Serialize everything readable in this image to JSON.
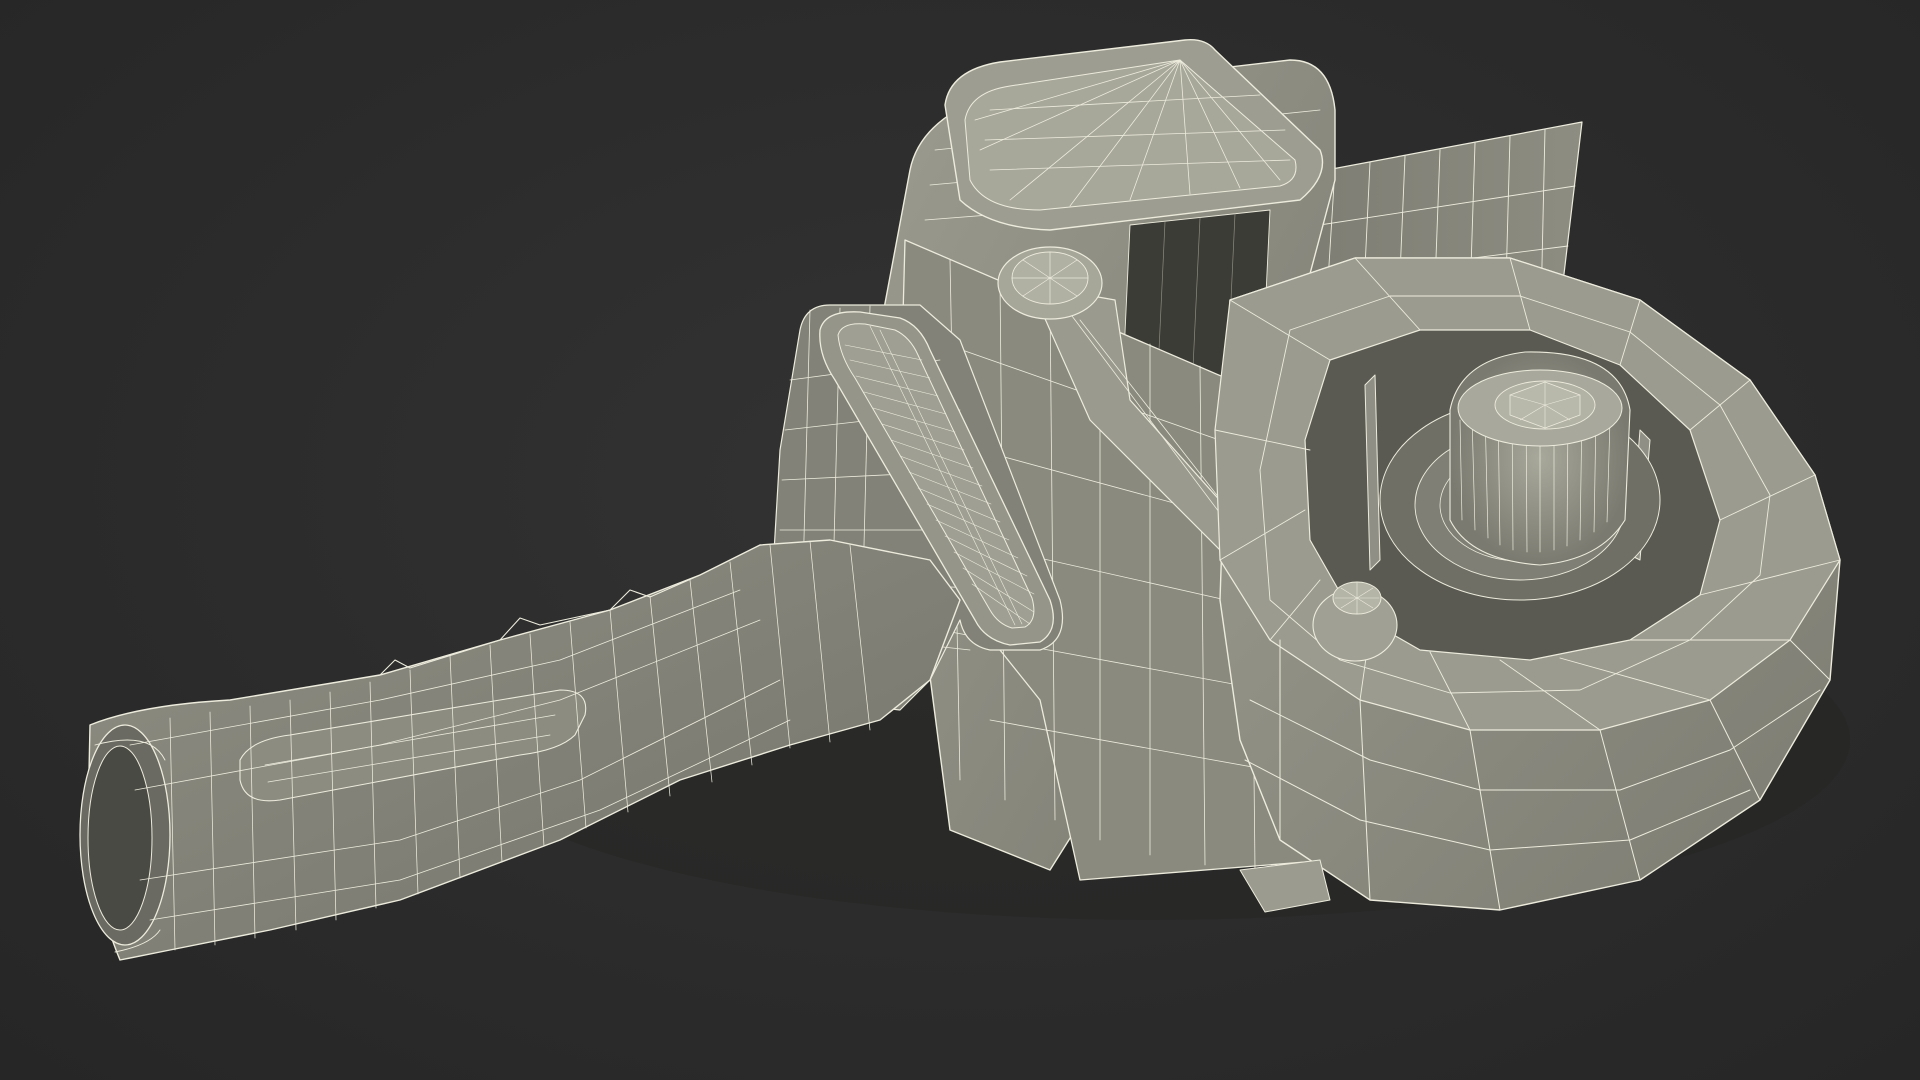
{
  "scene": {
    "background_color": "#2c2c2c",
    "surface_color": "#8a8a7e",
    "surface_light_color": "#a3a396",
    "surface_dark_color": "#55554d",
    "wire_color": "#ecebdc",
    "shadow_color": "#1f1f1c",
    "render_style": "wireframe-on-shaded",
    "subject_icon": "tape-dispenser-icon"
  }
}
